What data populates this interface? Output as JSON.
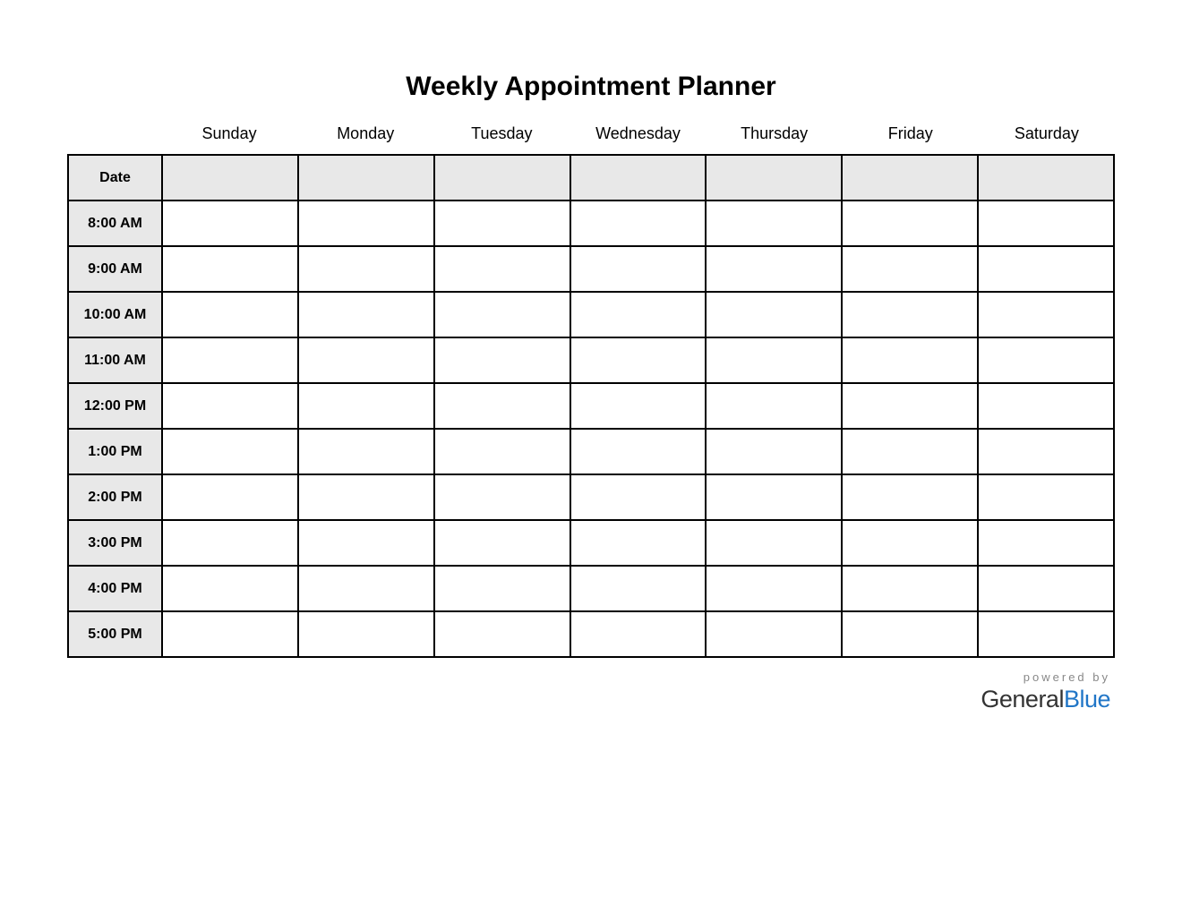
{
  "title": "Weekly Appointment Planner",
  "days": [
    "Sunday",
    "Monday",
    "Tuesday",
    "Wednesday",
    "Thursday",
    "Friday",
    "Saturday"
  ],
  "rows": [
    {
      "label": "Date",
      "isDateRow": true,
      "cells": [
        "",
        "",
        "",
        "",
        "",
        "",
        ""
      ]
    },
    {
      "label": "8:00 AM",
      "cells": [
        "",
        "",
        "",
        "",
        "",
        "",
        ""
      ]
    },
    {
      "label": "9:00 AM",
      "cells": [
        "",
        "",
        "",
        "",
        "",
        "",
        ""
      ]
    },
    {
      "label": "10:00 AM",
      "cells": [
        "",
        "",
        "",
        "",
        "",
        "",
        ""
      ]
    },
    {
      "label": "11:00 AM",
      "cells": [
        "",
        "",
        "",
        "",
        "",
        "",
        ""
      ]
    },
    {
      "label": "12:00 PM",
      "cells": [
        "",
        "",
        "",
        "",
        "",
        "",
        ""
      ]
    },
    {
      "label": "1:00 PM",
      "cells": [
        "",
        "",
        "",
        "",
        "",
        "",
        ""
      ]
    },
    {
      "label": "2:00 PM",
      "cells": [
        "",
        "",
        "",
        "",
        "",
        "",
        ""
      ]
    },
    {
      "label": "3:00 PM",
      "cells": [
        "",
        "",
        "",
        "",
        "",
        "",
        ""
      ]
    },
    {
      "label": "4:00 PM",
      "cells": [
        "",
        "",
        "",
        "",
        "",
        "",
        ""
      ]
    },
    {
      "label": "5:00 PM",
      "cells": [
        "",
        "",
        "",
        "",
        "",
        "",
        ""
      ]
    }
  ],
  "footer": {
    "poweredBy": "powered by",
    "brand1": "General",
    "brand2": "Blue"
  }
}
